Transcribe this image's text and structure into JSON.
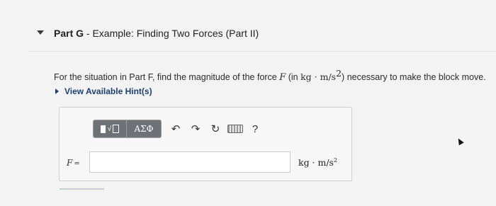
{
  "part": {
    "label": "Part G",
    "separator": " - ",
    "title": "Example: Finding Two Forces (Part II)"
  },
  "question": {
    "text_before": "For the situation in Part F, find the magnitude of the force ",
    "variable": "F",
    "unit_open": " (in ",
    "unit_kg": "kg",
    "unit_dot": " · ",
    "unit_ms": "m/s",
    "unit_exp": "2",
    "unit_close": ")",
    "text_after": " necessary to make the block move."
  },
  "hints": {
    "label": "View Available Hint(s)"
  },
  "toolbar": {
    "templates_icon": "templates-icon",
    "symbols_label": "ΑΣΦ",
    "undo_glyph": "↶",
    "redo_glyph": "↷",
    "reset_glyph": "↻",
    "keyboard_icon": "keyboard-icon",
    "help_glyph": "?"
  },
  "answer": {
    "variable": "F",
    "equals": "=",
    "value": "",
    "unit_base": "kg · m/s",
    "unit_exp": "2"
  }
}
